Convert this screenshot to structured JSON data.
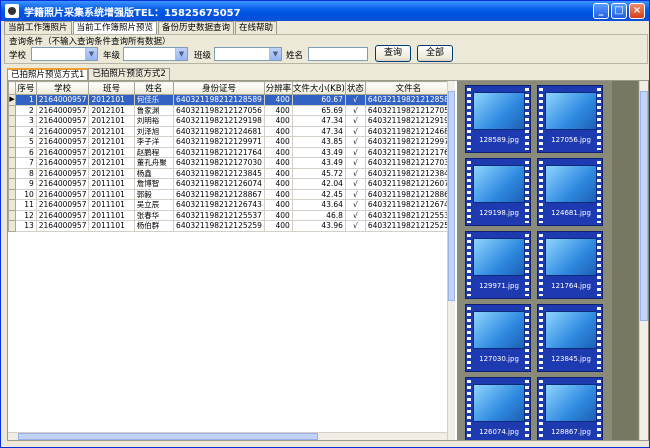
{
  "window": {
    "title": "学籍照片采集系统增强版TEL：15825675057"
  },
  "menu_tabs": [
    "当前工作簿照片",
    "当前工作簿照片预览",
    "备份历史数据查询",
    "在线帮助"
  ],
  "query": {
    "group_title": "查询条件（不输入查询条件查询所有数据）",
    "school_label": "学校",
    "grade_label": "年级",
    "class_label": "班级",
    "name_label": "姓名",
    "search_button": "查询",
    "all_button": "全部"
  },
  "sub_tabs": [
    "已拍照片预览方式1",
    "已拍照片预览方式2"
  ],
  "table": {
    "columns": [
      "序号",
      "学校",
      "班号",
      "姓名",
      "身份证号",
      "分辨率",
      "文件大小(KB)",
      "状态",
      "文件名"
    ],
    "rows": [
      [
        "1",
        "2164000957",
        "2012101",
        "何佳乐",
        "640321198212128589",
        "400",
        "60.67",
        "√",
        "64032119821212858"
      ],
      [
        "2",
        "2164000957",
        "2012101",
        "鲁家渊",
        "640321198212127056",
        "400",
        "65.69",
        "√",
        "64032119821212705"
      ],
      [
        "3",
        "2164000957",
        "2012101",
        "刘明裕",
        "640321198212129198",
        "400",
        "47.34",
        "√",
        "64032119821212919"
      ],
      [
        "4",
        "2164000957",
        "2012101",
        "刘泽旭",
        "640321198212124681",
        "400",
        "47.34",
        "√",
        "64032119821212468"
      ],
      [
        "5",
        "2164000957",
        "2012101",
        "李子洋",
        "640321198212129971",
        "400",
        "43.85",
        "√",
        "64032119821212997"
      ],
      [
        "6",
        "2164000957",
        "2012101",
        "赵鹏程",
        "640321198212121764",
        "400",
        "43.49",
        "√",
        "64032119821212176"
      ],
      [
        "7",
        "2164000957",
        "2012101",
        "董孔舟聚",
        "640321198212127030",
        "400",
        "43.49",
        "√",
        "64032119821212703"
      ],
      [
        "8",
        "2164000957",
        "2012101",
        "杨鑫",
        "640321198212123845",
        "400",
        "45.72",
        "√",
        "64032119821212384"
      ],
      [
        "9",
        "2164000957",
        "2011101",
        "詹博智",
        "640321198212126074",
        "400",
        "42.04",
        "√",
        "64032119821212607"
      ],
      [
        "10",
        "2164000957",
        "2011101",
        "郭毅",
        "640321198212128867",
        "400",
        "42.45",
        "√",
        "64032119821212886"
      ],
      [
        "11",
        "2164000957",
        "2011101",
        "吴立辰",
        "640321198212126743",
        "400",
        "43.64",
        "√",
        "64032119821212674"
      ],
      [
        "12",
        "2164000957",
        "2011101",
        "张春华",
        "640321198212125537",
        "400",
        "46.8",
        "√",
        "64032119821212553"
      ],
      [
        "13",
        "2164000957",
        "2011101",
        "杨伯群",
        "640321198212125259",
        "400",
        "43.96",
        "√",
        "64032119821212525"
      ]
    ]
  },
  "thumbnails": [
    "128589.jpg",
    "127056.jpg",
    "129198.jpg",
    "124681.jpg",
    "129971.jpg",
    "121764.jpg",
    "127030.jpg",
    "123845.jpg",
    "126074.jpg",
    "128867.jpg"
  ]
}
